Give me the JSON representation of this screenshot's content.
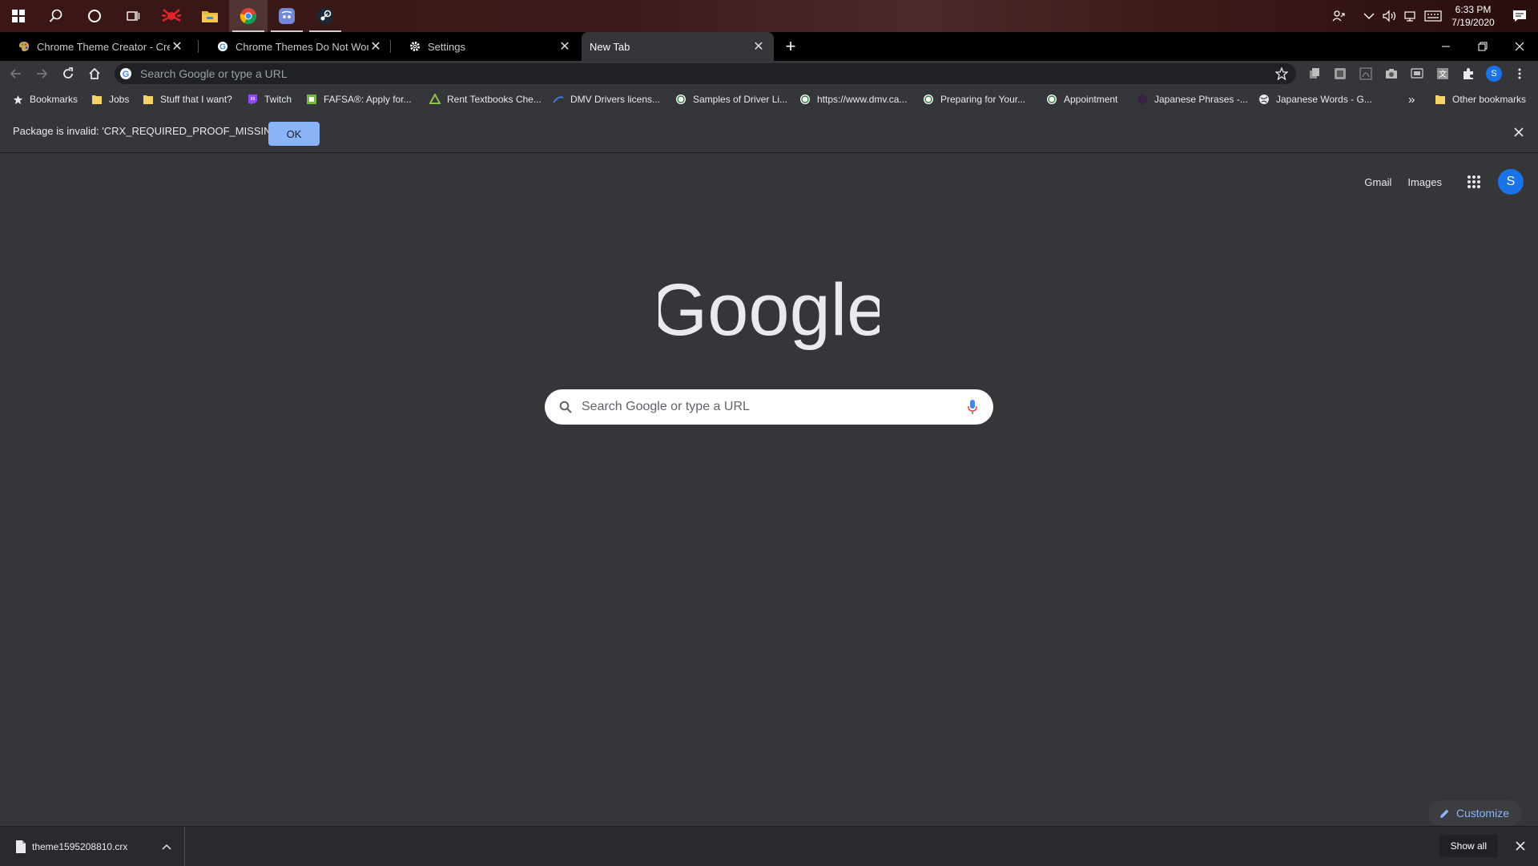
{
  "taskbar": {
    "time": "6:33 PM",
    "date": "7/19/2020"
  },
  "tabs": [
    {
      "title": "Chrome Theme Creator - Create",
      "icon": "theme-creator-icon"
    },
    {
      "title": "Chrome Themes Do Not Work - G",
      "icon": "google-g-icon"
    },
    {
      "title": "Settings",
      "icon": "gear-icon"
    },
    {
      "title": "New Tab",
      "icon": "none",
      "active": true
    }
  ],
  "omnibox": {
    "placeholder": "Search Google or type a URL"
  },
  "bookmarks": {
    "items": [
      {
        "label": "Bookmarks"
      },
      {
        "label": "Jobs"
      },
      {
        "label": "Stuff that I want?"
      },
      {
        "label": "Twitch"
      },
      {
        "label": "FAFSA®: Apply for..."
      },
      {
        "label": "Rent Textbooks Che..."
      },
      {
        "label": "DMV Drivers licens..."
      },
      {
        "label": "Samples of Driver Li..."
      },
      {
        "label": "https://www.dmv.ca..."
      },
      {
        "label": "Preparing for Your..."
      },
      {
        "label": "Appointment"
      },
      {
        "label": "Japanese Phrases -..."
      },
      {
        "label": "Japanese Words - G..."
      }
    ],
    "overflow": "»",
    "other": "Other bookmarks"
  },
  "infobar": {
    "message": "Package is invalid: 'CRX_REQUIRED_PROOF_MISSING'.",
    "ok_label": "OK"
  },
  "ntp": {
    "gmail": "Gmail",
    "images": "Images",
    "avatar_letter": "S",
    "logo_text": "Google",
    "search_placeholder": "Search Google or type a URL",
    "customize": "Customize"
  },
  "downloads": {
    "filename": "theme1595208810.crx",
    "show_all": "Show all"
  },
  "profile": {
    "letter": "S"
  },
  "colors": {
    "background": "#35363a",
    "accent": "#8ab4f8",
    "avatar": "#1a73e8"
  }
}
